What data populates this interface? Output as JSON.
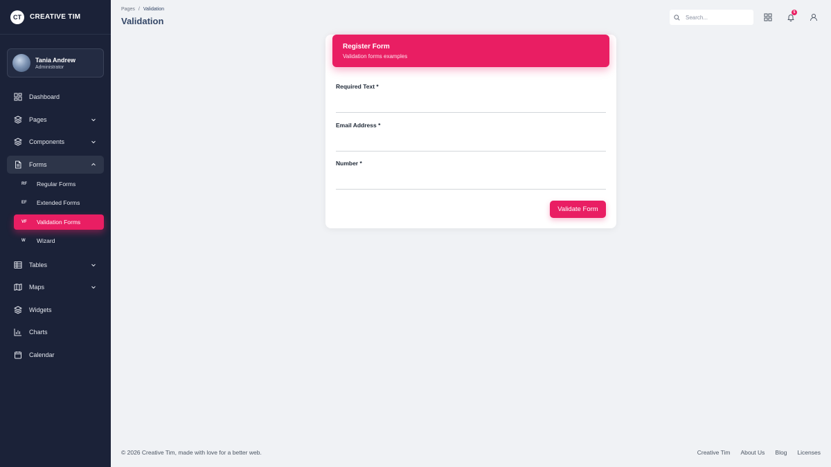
{
  "brand": {
    "logo_text": "CT",
    "name": "CREATIVE TIM"
  },
  "user": {
    "name": "Tania Andrew",
    "role": "Administrator"
  },
  "sidebar": {
    "items": [
      {
        "label": "Dashboard",
        "icon": "dashboard-icon"
      },
      {
        "label": "Pages",
        "icon": "layers-icon"
      },
      {
        "label": "Components",
        "icon": "layers-icon"
      },
      {
        "label": "Forms",
        "icon": "document-icon"
      },
      {
        "label": "Tables",
        "icon": "table-icon"
      },
      {
        "label": "Maps",
        "icon": "map-icon"
      },
      {
        "label": "Widgets",
        "icon": "layers-icon"
      },
      {
        "label": "Charts",
        "icon": "bar-chart-icon"
      },
      {
        "label": "Calendar",
        "icon": "calendar-icon"
      }
    ],
    "forms_sub": [
      {
        "abbr": "RF",
        "label": "Regular Forms"
      },
      {
        "abbr": "EF",
        "label": "Extended Forms"
      },
      {
        "abbr": "VF",
        "label": "Validation Forms"
      },
      {
        "abbr": "W",
        "label": "Wizard"
      }
    ]
  },
  "breadcrumb": {
    "parent": "Pages",
    "separator": "/",
    "current": "Validation"
  },
  "page_title": "Validation",
  "search": {
    "placeholder": "Search..."
  },
  "notifications": {
    "count": "5"
  },
  "card": {
    "title": "Register Form",
    "subtitle": "Validation forms examples",
    "fields": [
      {
        "label": "Required Text *"
      },
      {
        "label": "Email Address *"
      },
      {
        "label": "Number *"
      }
    ],
    "submit_label": "Validate Form"
  },
  "footer": {
    "copyright": "© 2026 Creative Tim, made with love for a better web.",
    "links": [
      "Creative Tim",
      "About Us",
      "Blog",
      "Licenses"
    ]
  },
  "colors": {
    "accent": "#e91e63",
    "sidebar_bg": "#1b2238",
    "page_bg": "#f0f2f5"
  }
}
